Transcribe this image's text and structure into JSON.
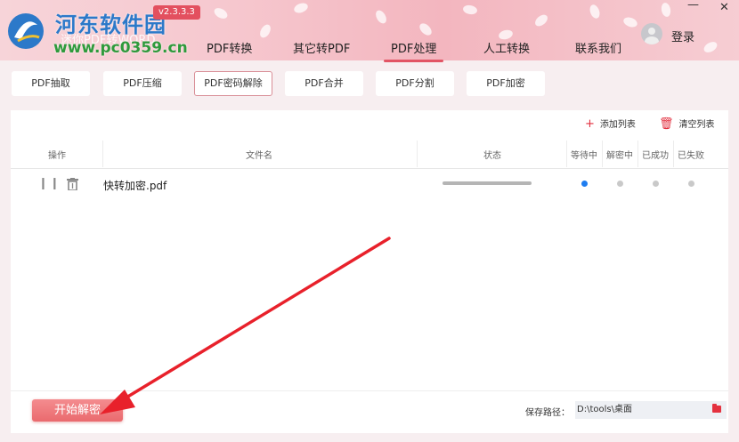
{
  "watermark": {
    "site_name": "河东软件园",
    "app_sub": "迷你PDF转WORD",
    "url": "www.pc0359.cn"
  },
  "header": {
    "version": "v2.3.3.3",
    "nav": [
      {
        "label": "PDF转换"
      },
      {
        "label": "其它转PDF"
      },
      {
        "label": "PDF处理"
      },
      {
        "label": "人工转换"
      },
      {
        "label": "联系我们"
      }
    ],
    "active_nav": "PDF处理",
    "login": "登录",
    "minimize": "—",
    "close": "✕"
  },
  "subtabs": [
    {
      "label": "PDF抽取"
    },
    {
      "label": "PDF压缩"
    },
    {
      "label": "PDF密码解除"
    },
    {
      "label": "PDF合并"
    },
    {
      "label": "PDF分割"
    },
    {
      "label": "PDF加密"
    }
  ],
  "active_subtab": "PDF密码解除",
  "toolbar": {
    "add_list": "添加列表",
    "clear_list": "清空列表"
  },
  "table": {
    "headers": {
      "action": "操作",
      "filename": "文件名",
      "status": "状态",
      "waiting": "等待中",
      "decrypting": "解密中",
      "success": "已成功",
      "failed": "已失败"
    },
    "rows": [
      {
        "filename": "快转加密.pdf",
        "state": "等待中"
      }
    ]
  },
  "footer": {
    "start": "开始解密",
    "save_path_label": "保存路径：",
    "save_path": "D:\\tools\\桌面"
  },
  "colors": {
    "accent": "#e25565",
    "start_button": "#ee7377",
    "waiting_dot": "#1e7df0",
    "arrow": "#e8212b"
  }
}
